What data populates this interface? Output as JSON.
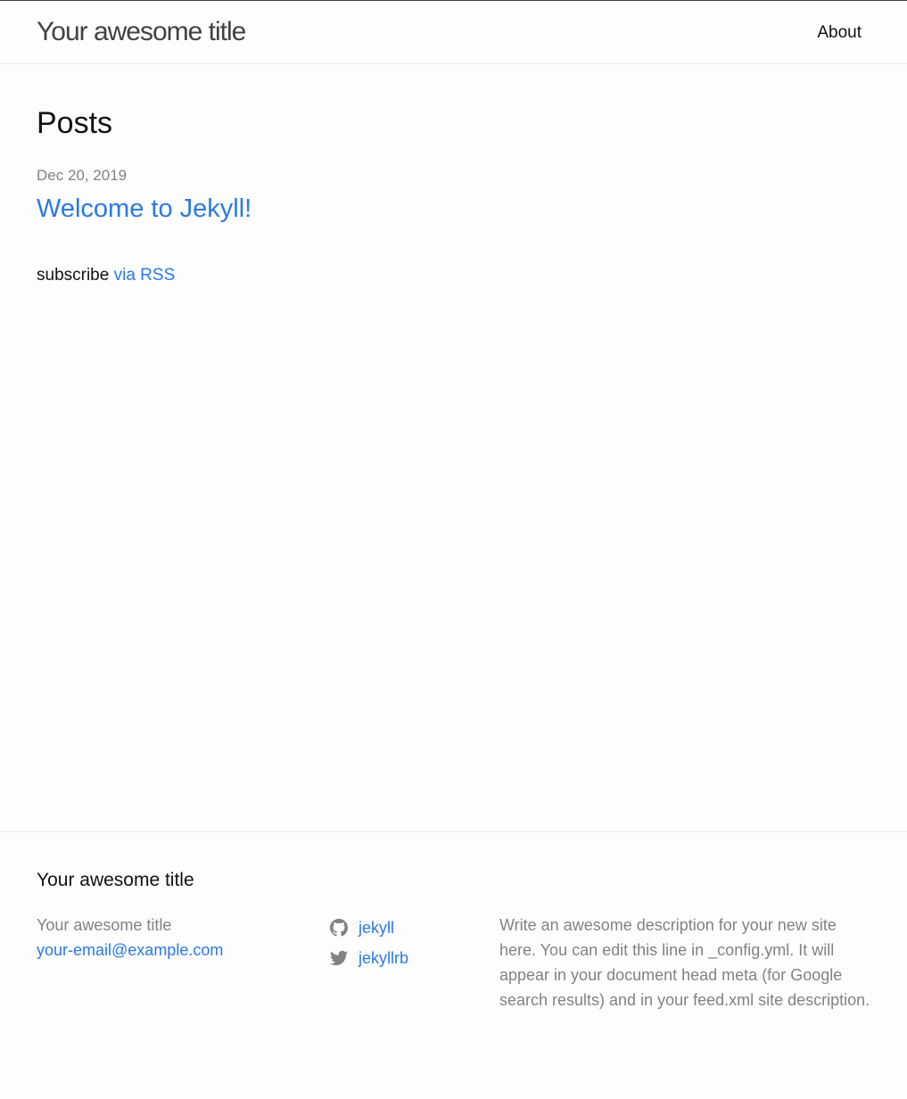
{
  "header": {
    "site_title": "Your awesome title",
    "nav": [
      {
        "label": "About"
      }
    ]
  },
  "main": {
    "heading": "Posts",
    "posts": [
      {
        "date": "Dec 20, 2019",
        "title": "Welcome to Jekyll!"
      }
    ],
    "rss": {
      "prefix": "subscribe",
      "link_label": "via RSS"
    }
  },
  "footer": {
    "heading": "Your awesome title",
    "col1": {
      "name": "Your awesome title",
      "email": "your-email@example.com"
    },
    "social": [
      {
        "icon": "github-icon",
        "label": "jekyll"
      },
      {
        "icon": "twitter-icon",
        "label": "jekyllrb"
      }
    ],
    "description": "Write an awesome description for your new site here. You can edit this line in _config.yml. It will appear in your document head meta (for Google search results) and in your feed.xml site description."
  },
  "colors": {
    "link": "#2a7ae2",
    "text": "#111111",
    "muted": "#828282",
    "border": "#e8e8e8",
    "background": "#fdfdfd"
  }
}
